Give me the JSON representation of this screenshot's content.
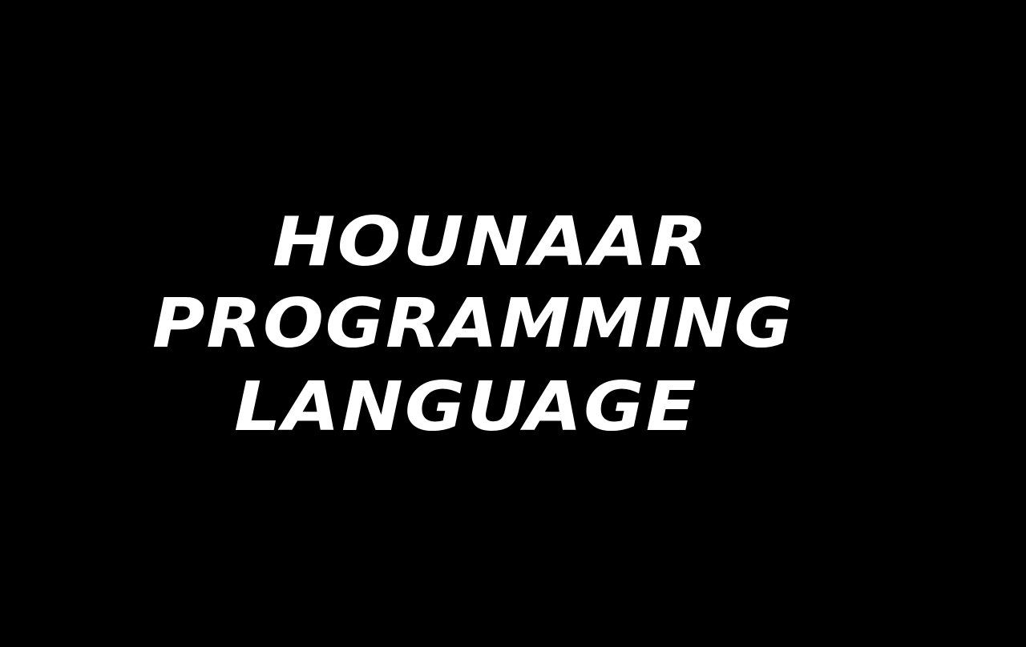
{
  "title": {
    "lines": [
      "HOUNAAR",
      "PROGRAMMING",
      "LANGUAGE"
    ]
  },
  "colors": {
    "background": "#000000",
    "text": "#ffffff"
  }
}
